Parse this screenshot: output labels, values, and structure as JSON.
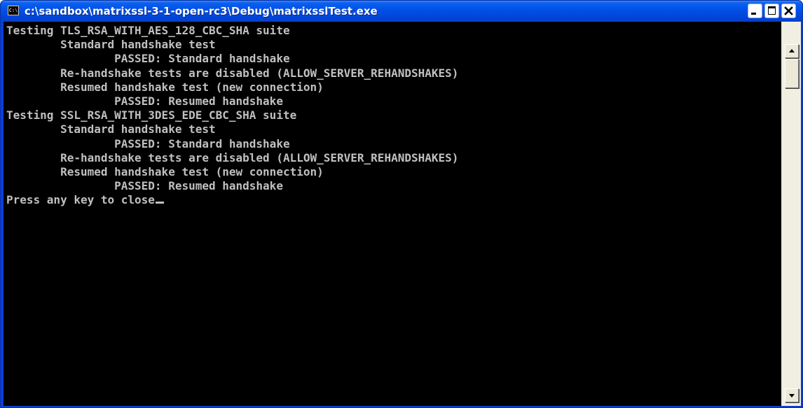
{
  "window": {
    "title": "c:\\sandbox\\matrixssl-3-1-open-rc3\\Debug\\matrixsslTest.exe",
    "icon_text": "C:\\",
    "icon": "console-app-icon"
  },
  "titlebar_buttons": {
    "minimize_icon": "minimize-icon",
    "maximize_icon": "maximize-icon",
    "close_icon": "close-icon"
  },
  "console": {
    "lines": [
      "Testing TLS_RSA_WITH_AES_128_CBC_SHA suite",
      "        Standard handshake test",
      "                PASSED: Standard handshake",
      "        Re-handshake tests are disabled (ALLOW_SERVER_REHANDSHAKES)",
      "        Resumed handshake test (new connection)",
      "                PASSED: Resumed handshake",
      "Testing SSL_RSA_WITH_3DES_EDE_CBC_SHA suite",
      "        Standard handshake test",
      "                PASSED: Standard handshake",
      "        Re-handshake tests are disabled (ALLOW_SERVER_REHANDSHAKES)",
      "        Resumed handshake test (new connection)",
      "                PASSED: Resumed handshake",
      "Press any key to close"
    ]
  },
  "colors": {
    "console_background": "#000000",
    "console_text": "#c0c0c0",
    "titlebar": "#0250e6"
  },
  "scrollbar": {
    "up_icon": "scroll-up-arrow-icon",
    "down_icon": "scroll-down-arrow-icon"
  }
}
